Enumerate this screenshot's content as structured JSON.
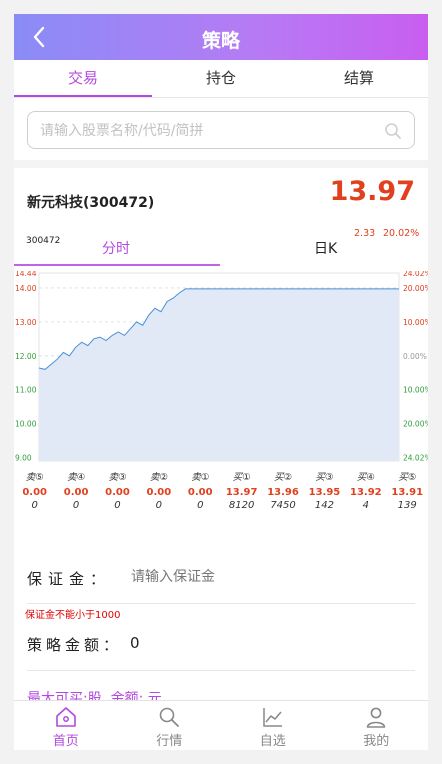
{
  "header": {
    "title": "策略"
  },
  "tabs": [
    {
      "label": "交易",
      "active": true
    },
    {
      "label": "持仓",
      "active": false
    },
    {
      "label": "结算",
      "active": false
    }
  ],
  "search": {
    "placeholder": "请输入股票名称/代码/简拼",
    "value": ""
  },
  "quote": {
    "name": "新元科技(300472)",
    "price": "13.97",
    "change": "2.33",
    "change_pct": "20.02%",
    "code": "300472",
    "chart_tabs": [
      "分时",
      "日K"
    ]
  },
  "chart_data": {
    "type": "area",
    "y_left_ticks": [
      "14.44",
      "14.00",
      "13.00",
      "12.00",
      "11.00",
      "10.00",
      "9.00"
    ],
    "y_right_ticks": [
      "24.02%",
      "20.00%",
      "10.00%",
      "0.00%",
      "10.00%",
      "20.00%",
      "24.02%"
    ],
    "ylim": [
      8.9,
      14.44
    ],
    "y": [
      11.64,
      11.6,
      11.75,
      11.9,
      12.1,
      12.0,
      12.25,
      12.4,
      12.3,
      12.5,
      12.55,
      12.45,
      12.6,
      12.7,
      12.6,
      12.8,
      13.0,
      12.9,
      13.2,
      13.4,
      13.3,
      13.6,
      13.7,
      13.85,
      13.97,
      13.97,
      13.97,
      13.97,
      13.97,
      13.97,
      13.97,
      13.97,
      13.97,
      13.97,
      13.97,
      13.97,
      13.97,
      13.97,
      13.97,
      13.97,
      13.97,
      13.97,
      13.97,
      13.97,
      13.97,
      13.97,
      13.97,
      13.97,
      13.97,
      13.97,
      13.97,
      13.97,
      13.97,
      13.97,
      13.97,
      13.97,
      13.97,
      13.97,
      13.97,
      13.97
    ],
    "line_color": "#4a8fd8",
    "fill_color": "#e0e9f5",
    "up_color": "#e0401e",
    "down_color": "#2e9e3a"
  },
  "order_book": [
    {
      "label": "卖⑤",
      "price": "0.00",
      "volume": "0",
      "color": "#e0401e"
    },
    {
      "label": "卖④",
      "price": "0.00",
      "volume": "0",
      "color": "#e0401e"
    },
    {
      "label": "卖③",
      "price": "0.00",
      "volume": "0",
      "color": "#e0401e"
    },
    {
      "label": "卖②",
      "price": "0.00",
      "volume": "0",
      "color": "#e0401e"
    },
    {
      "label": "卖①",
      "price": "0.00",
      "volume": "0",
      "color": "#e0401e"
    },
    {
      "label": "买①",
      "price": "13.97",
      "volume": "8120",
      "color": "#e0401e"
    },
    {
      "label": "买②",
      "price": "13.96",
      "volume": "7450",
      "color": "#e0401e"
    },
    {
      "label": "买③",
      "price": "13.95",
      "volume": "142",
      "color": "#e0401e"
    },
    {
      "label": "买④",
      "price": "13.92",
      "volume": "4",
      "color": "#e0401e"
    },
    {
      "label": "买⑤",
      "price": "13.91",
      "volume": "139",
      "color": "#e0401e"
    }
  ],
  "form": {
    "margin_label": "保证金",
    "colon": "：",
    "margin_placeholder": "请输入保证金",
    "margin_warning": "保证金不能小于1000",
    "amount_label": "策略金额",
    "amount_colon": "：",
    "amount_value": "0",
    "max_buy": "最大可买:股, 金额: 元"
  },
  "nav": [
    {
      "label": "首页",
      "icon": "home-icon",
      "active": true
    },
    {
      "label": "行情",
      "icon": "search-icon",
      "active": false
    },
    {
      "label": "自选",
      "icon": "chart-line-icon",
      "active": false
    },
    {
      "label": "我的",
      "icon": "user-icon",
      "active": false
    }
  ],
  "colors": {
    "accent": "#b349e0",
    "header_start": "#8a8cf6",
    "header_end": "#c85ef0"
  }
}
